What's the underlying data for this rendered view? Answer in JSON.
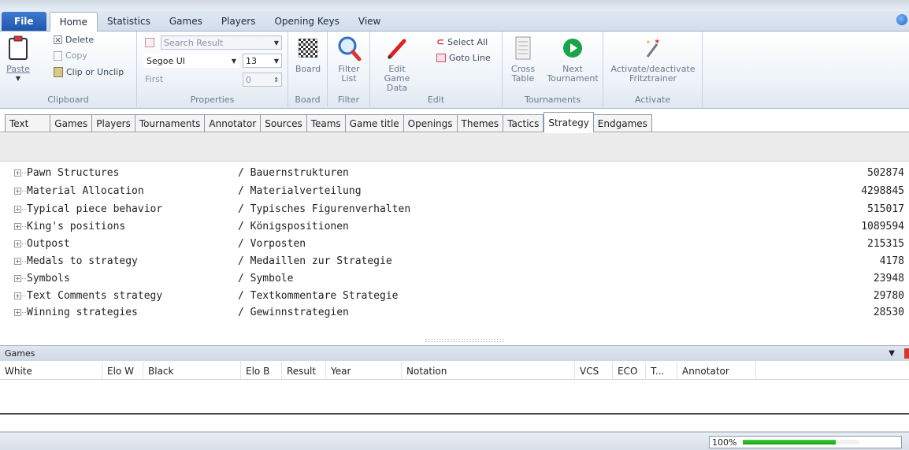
{
  "ribbon_tabs": [
    "File",
    "Home",
    "Statistics",
    "Games",
    "Players",
    "Opening Keys",
    "View"
  ],
  "clipboard": {
    "paste_label": "Paste",
    "delete_label": "Delete",
    "copy_label": "Copy",
    "clip_label": "Clip or Unclip",
    "group_label": "Clipboard"
  },
  "properties": {
    "search_placeholder": "Search Result",
    "font_value": "Segoe UI",
    "size_value": "13",
    "first_label": "First",
    "first_value": "0",
    "group_label": "Properties"
  },
  "board": {
    "button_label": "Board",
    "group_label": "Board"
  },
  "filter": {
    "button_label_1": "Filter",
    "button_label_2": "List",
    "group_label": "Filter"
  },
  "edit": {
    "edit_game_label_1": "Edit Game",
    "edit_game_label_2": "Data",
    "select_all_label": "Select All",
    "goto_line_label": "Goto Line",
    "group_label": "Edit"
  },
  "tournaments": {
    "cross_label_1": "Cross",
    "cross_label_2": "Table",
    "next_label_1": "Next",
    "next_label_2": "Tournament",
    "group_label": "Tournaments"
  },
  "activate": {
    "button_label_1": "Activate/deactivate",
    "button_label_2": "Fritztrainer",
    "group_label": "Activate"
  },
  "content_tabs": [
    "Text",
    "Games",
    "Players",
    "Tournaments",
    "Annotator",
    "Sources",
    "Teams",
    "Game title",
    "Openings",
    "Themes",
    "Tactics",
    "Strategy",
    "Endgames"
  ],
  "active_content_tab": "Strategy",
  "tree_rows": [
    {
      "name": "Pawn Structures",
      "german": "/ Bauernstrukturen",
      "count": "502874"
    },
    {
      "name": "Material Allocation",
      "german": "/ Materialverteilung",
      "count": "4298845"
    },
    {
      "name": "Typical piece behavior",
      "german": "/ Typisches Figurenverhalten",
      "count": "515017"
    },
    {
      "name": "King's positions",
      "german": "/ Königspositionen",
      "count": "1089594"
    },
    {
      "name": "Outpost",
      "german": "/ Vorposten",
      "count": "215315"
    },
    {
      "name": "Medals to strategy",
      "german": "/ Medaillen zur Strategie",
      "count": "4178"
    },
    {
      "name": "Symbols",
      "german": "/ Symbole",
      "count": "23948"
    },
    {
      "name": "Text Comments strategy",
      "german": "/ Textkommentare Strategie",
      "count": "29780"
    },
    {
      "name": "Winning strategies",
      "german": "/ Gewinnstrategien",
      "count": "28530"
    }
  ],
  "games_panel": {
    "title": "Games",
    "columns": [
      "White",
      "Elo W",
      "Black",
      "Elo B",
      "Result",
      "Year",
      "Notation",
      "VCS",
      "ECO",
      "T...",
      "Annotator"
    ]
  },
  "status": {
    "zoom_label": "100%",
    "zoom_fraction": 0.8
  },
  "colors": {
    "file_tab": "#1f56ad",
    "progress": "#14a114",
    "accent_red": "#d23a2a",
    "accent_green": "#1aa34a"
  }
}
